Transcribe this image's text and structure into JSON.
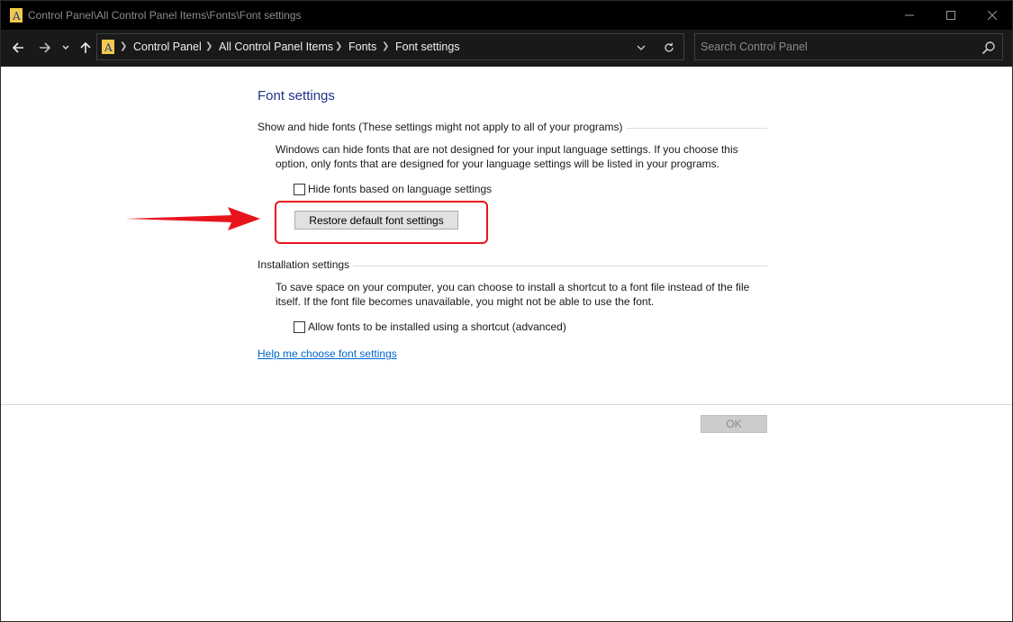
{
  "window": {
    "title": "Control Panel\\All Control Panel Items\\Fonts\\Font settings"
  },
  "breadcrumb": [
    "Control Panel",
    "All Control Panel Items",
    "Fonts",
    "Font settings"
  ],
  "search": {
    "placeholder": "Search Control Panel"
  },
  "page": {
    "heading": "Font settings",
    "show_hide": {
      "label": "Show and hide fonts (These settings might not apply to all of your programs)",
      "description": "Windows can hide fonts that are not designed for your input language settings. If you choose this option, only fonts that are designed for your language settings will be listed in your programs.",
      "checkbox_label": "Hide fonts based on language settings",
      "checkbox_checked": false,
      "restore_button": "Restore default font settings"
    },
    "installation": {
      "label": "Installation settings",
      "description": "To save space on your computer, you can choose to install a shortcut to a font file instead of the file itself. If the font file becomes unavailable, you might not be able to use the font.",
      "checkbox_label": "Allow fonts to be installed using a shortcut (advanced)",
      "checkbox_checked": false
    },
    "help_link": "Help me choose font settings",
    "ok_button": "OK"
  },
  "colors": {
    "heading": "#1e3287",
    "link": "#0066cc",
    "annotation": "#e8141c",
    "titlebar": "#000000"
  }
}
